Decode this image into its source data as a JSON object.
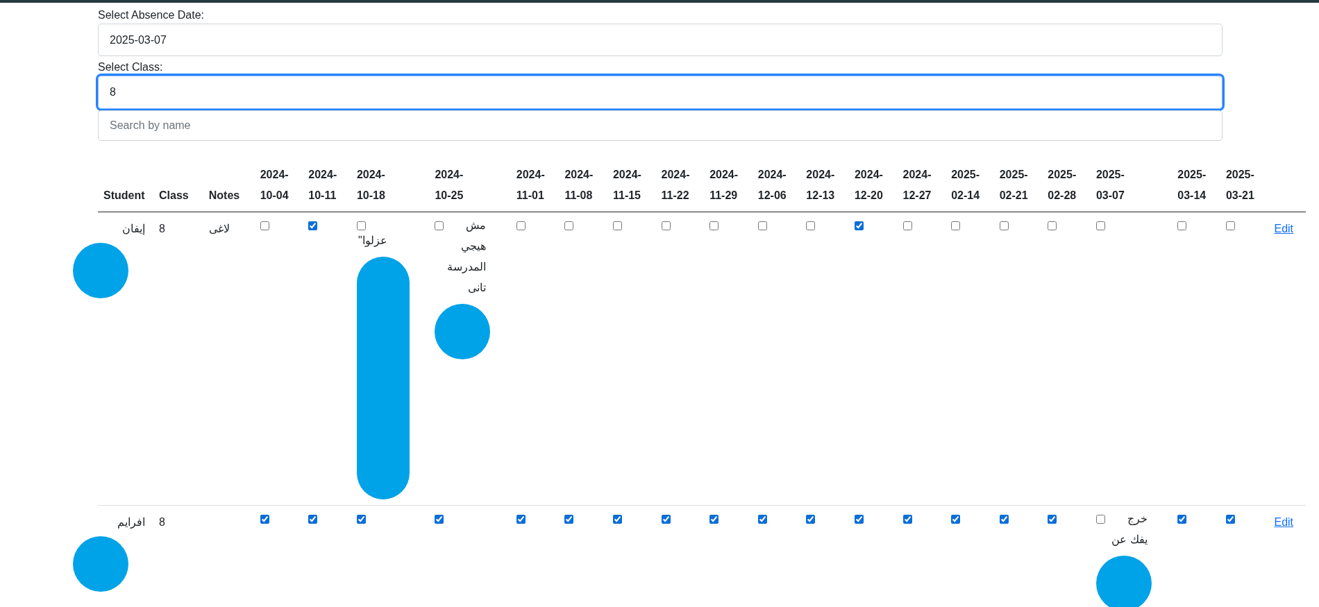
{
  "form": {
    "date_label": "Select Absence Date:",
    "date_value": "2025-03-07",
    "class_label": "Select Class:",
    "class_value": "8",
    "class_focused": true,
    "search_placeholder": "Search by name"
  },
  "table": {
    "columns": [
      "Student",
      "Class",
      "Notes",
      "2024-10-04",
      "2024-10-11",
      "2024-10-18",
      "2024-10-25",
      "2024-11-01",
      "2024-11-08",
      "2024-11-15",
      "2024-11-22",
      "2024-11-29",
      "2024-12-06",
      "2024-12-13",
      "2024-12-20",
      "2024-12-27",
      "2025-02-14",
      "2025-02-21",
      "2025-02-28",
      "2025-03-07",
      "2025-03-14",
      "2025-03-21"
    ],
    "rows": [
      {
        "student": "إيفان",
        "student_redacted": true,
        "class": "8",
        "notes": "لاغى",
        "action": "Edit",
        "absences": [
          {
            "checked": false
          },
          {
            "checked": true
          },
          {
            "checked": false,
            "note": "عزلوا\"",
            "note_below": true,
            "redacted": true,
            "tall": true
          },
          {
            "checked": false,
            "note": "مش هيجي المدرسة تانى",
            "redacted": true
          },
          {
            "checked": false
          },
          {
            "checked": false
          },
          {
            "checked": false
          },
          {
            "checked": false
          },
          {
            "checked": false
          },
          {
            "checked": false
          },
          {
            "checked": false
          },
          {
            "checked": true
          },
          {
            "checked": false
          },
          {
            "checked": false
          },
          {
            "checked": false
          },
          {
            "checked": false
          },
          {
            "checked": false
          },
          {
            "checked": false
          },
          {
            "checked": false
          }
        ]
      },
      {
        "student": "افرايم",
        "student_redacted": true,
        "class": "8",
        "action": "Edit",
        "absences": [
          {
            "checked": true
          },
          {
            "checked": true
          },
          {
            "checked": true
          },
          {
            "checked": true
          },
          {
            "checked": true
          },
          {
            "checked": true
          },
          {
            "checked": true
          },
          {
            "checked": true
          },
          {
            "checked": true
          },
          {
            "checked": true
          },
          {
            "checked": true
          },
          {
            "checked": true
          },
          {
            "checked": true
          },
          {
            "checked": true
          },
          {
            "checked": true
          },
          {
            "checked": true
          },
          {
            "checked": false,
            "note": "خرج يفك عن",
            "redacted": true
          },
          {
            "checked": true
          },
          {
            "checked": true
          }
        ]
      }
    ]
  }
}
